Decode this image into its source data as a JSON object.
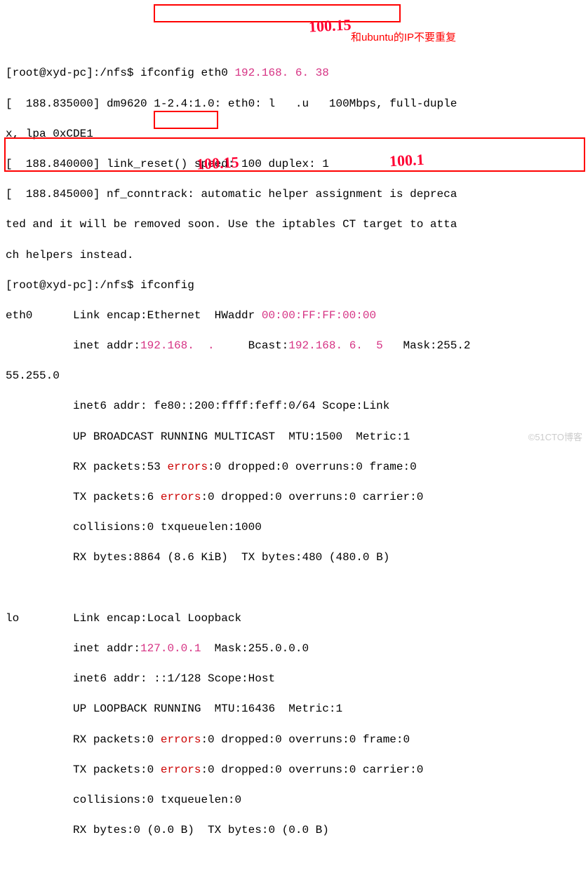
{
  "line1": {
    "prompt": "[root@xyd-pc]:/nfs$ ",
    "cmd": "ifconfig eth0 ",
    "ip": "192.168. 6. 38"
  },
  "line2a": "[  188.835000] dm9620 1-2.4:1.0: eth0: l   .u   100Mbps, full-duple",
  "line2b": "x, lpa 0xCDE1",
  "line3": "[  188.840000] link_reset() speed: 100 duplex: 1",
  "line4a": "[  188.845000] nf_conntrack: automatic helper assignment is depreca",
  "line4b": "ted and it will be removed soon. Use the iptables CT target to atta",
  "line4c": "ch helpers instead.",
  "line5": {
    "prompt": "[root@xyd-pc]:/nfs$ ",
    "cmd": "ifconfig"
  },
  "eth0": {
    "l1a": "eth0      Link encap:Ethernet  HWaddr ",
    "hwaddr": "00:00:FF:FF:00:00",
    "l2a": "          inet addr:",
    "inet": "192.168.  .  ",
    "l2b": "   Bcast:",
    "bcast": "192.168. 6.  5",
    "l2c": "   Mask:255.2",
    "l2d": "55.255.0",
    "l3": "          inet6 addr: fe80::200:ffff:feff:0/64 Scope:Link",
    "l4": "          UP BROADCAST RUNNING MULTICAST  MTU:1500  Metric:1",
    "l5a": "          RX packets:53 ",
    "l5b": ":0 dropped:0 overruns:0 frame:0",
    "l6a": "          TX packets:6 ",
    "l6b": ":0 dropped:0 overruns:0 carrier:0",
    "l7": "          collisions:0 txqueuelen:1000",
    "l8": "          RX bytes:8864 (8.6 KiB)  TX bytes:480 (480.0 B)"
  },
  "lo": {
    "l1": "lo        Link encap:Local Loopback",
    "l2a": "          inet addr:",
    "inet": "127.0.0.1",
    "l2b": "  Mask:255.0.0.0",
    "l3": "          inet6 addr: ::1/128 Scope:Host",
    "l4": "          UP LOOPBACK RUNNING  MTU:16436  Metric:1",
    "l5a": "          RX packets:0 ",
    "l5b": ":0 dropped:0 overruns:0 frame:0",
    "l6a": "          TX packets:0 ",
    "l6b": ":0 dropped:0 overruns:0 carrier:0",
    "l7": "          collisions:0 txqueuelen:0",
    "l8": "          RX bytes:0 (0.0 B)  TX bytes:0 (0.0 B)"
  },
  "errors_label": "errors",
  "annotation_text": "和ubuntu的IP不要重复",
  "handwritten1": "100.15",
  "handwritten2": "100.15",
  "handwritten3": "100.1",
  "watermark": "©51CTO博客"
}
